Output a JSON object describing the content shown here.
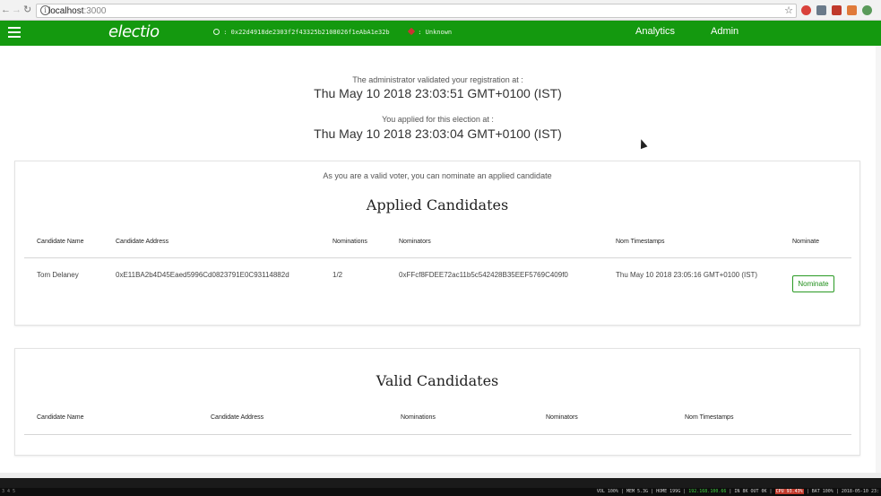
{
  "browser": {
    "host": "localhost",
    "port": ":3000",
    "back_icon": "arrow-left-icon",
    "forward_icon": "arrow-right-icon",
    "reload_icon": "reload-icon"
  },
  "navbar": {
    "brand": "electio",
    "account_address": ": 0x22d4918de2303f2f43325b2108026f1eAbA1e32b",
    "account_status": ": Unknown",
    "links": [
      "Analytics",
      "Admin"
    ],
    "color": "#14990f"
  },
  "registration": {
    "validated_label": "The administrator validated your registration at :",
    "validated_time": "Thu May 10 2018 23:03:51 GMT+0100 (IST)",
    "applied_label": "You applied for this election at :",
    "applied_time": "Thu May 10 2018 23:03:04 GMT+0100 (IST)"
  },
  "applied": {
    "note": "As you are a valid voter, you can nominate an applied candidate",
    "title": "Applied Candidates",
    "headers": [
      "Candidate Name",
      "Candidate Address",
      "Nominations",
      "Nominators",
      "Nom Timestamps",
      "Nominate"
    ],
    "rows": [
      {
        "name": "Tom Delaney",
        "address": "0xE11BA2b4D45Eaed5996Cd0823791E0C93114882d",
        "nominations": "1/2",
        "nominators": "0xFFcf8FDEE72ac11b5c542428B35EEF5769C409f0",
        "timestamp": "Thu May 10 2018 23:05:16 GMT+0100 (IST)",
        "action": "Nominate"
      }
    ]
  },
  "valid": {
    "title": "Valid Candidates",
    "headers": [
      "Candidate Name",
      "Candidate Address",
      "Nominations",
      "Nominators",
      "Nom Timestamps"
    ]
  },
  "statusbar": {
    "workspaces": "3 4 5",
    "vol": "VOL 100%",
    "mem": "MEM 5.3G",
    "home": "HOME 199G",
    "ip": "192.168.100.66",
    "net": "IN 8K OUT 0K",
    "cpu": "CPU 93.43%",
    "bat": "BAT 100%",
    "date": "2018-05-10 23:"
  }
}
